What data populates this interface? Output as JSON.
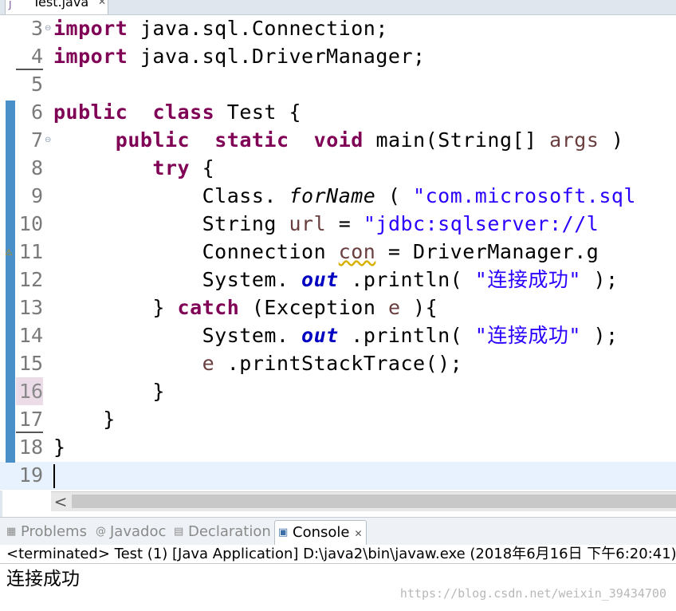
{
  "editor_tab": {
    "title": "Test.java",
    "close": "✕"
  },
  "icons": {
    "java_file": "java-file-icon",
    "fold": "fold-minus-icon",
    "warning": "warning-bulb-icon"
  },
  "code_lines": [
    {
      "num": "3",
      "tokens": [
        [
          "kw",
          "import"
        ],
        [
          "",
          "java.sql.Connection;"
        ]
      ]
    },
    {
      "num": "4",
      "tokens": [
        [
          "kw",
          "import"
        ],
        [
          "",
          "java.sql.DriverManager;"
        ]
      ]
    },
    {
      "num": "5",
      "tokens": []
    },
    {
      "num": "6",
      "tokens": [
        [
          "kw",
          "public"
        ],
        [
          "",
          ""
        ],
        [
          "kw",
          "class"
        ],
        [
          "",
          "Test {"
        ]
      ]
    },
    {
      "num": "7",
      "tokens": [
        [
          "",
          ""
        ],
        [
          "kw",
          "public"
        ],
        [
          "",
          ""
        ],
        [
          "kw",
          "static"
        ],
        [
          "",
          ""
        ],
        [
          "kw",
          "void"
        ],
        [
          "",
          "main(String[]"
        ],
        [
          "var",
          "args"
        ],
        [
          "",
          ")"
        ]
      ]
    },
    {
      "num": "8",
      "tokens": [
        [
          "kw",
          "try"
        ],
        [
          "",
          "{"
        ]
      ]
    },
    {
      "num": "9",
      "tokens": [
        [
          "",
          "Class."
        ],
        [
          "ital",
          "forName"
        ],
        [
          "",
          "("
        ],
        [
          "str",
          "\"com.microsoft.sql"
        ]
      ]
    },
    {
      "num": "10",
      "tokens": [
        [
          "",
          "String"
        ],
        [
          "var",
          "url"
        ],
        [
          "",
          "="
        ],
        [
          "str",
          "\"jdbc:sqlserver://l"
        ]
      ]
    },
    {
      "num": "11",
      "tokens": [
        [
          "",
          "Connection"
        ],
        [
          "var squig",
          "con"
        ],
        [
          "",
          "= DriverManager.g"
        ]
      ]
    },
    {
      "num": "12",
      "tokens": [
        [
          "",
          "System."
        ],
        [
          "fld",
          "out"
        ],
        [
          "",
          ".println("
        ],
        [
          "str",
          "\"连接成功\""
        ],
        [
          "",
          ");"
        ]
      ]
    },
    {
      "num": "13",
      "tokens": [
        [
          "",
          "}"
        ],
        [
          "kw",
          "catch"
        ],
        [
          "",
          "(Exception"
        ],
        [
          "var",
          "e"
        ],
        [
          "",
          "){"
        ]
      ]
    },
    {
      "num": "14",
      "tokens": [
        [
          "",
          "System."
        ],
        [
          "fld",
          "out"
        ],
        [
          "",
          ".println("
        ],
        [
          "str",
          "\"连接成功\""
        ],
        [
          "",
          ");"
        ]
      ]
    },
    {
      "num": "15",
      "tokens": [
        [
          "var",
          "e"
        ],
        [
          "",
          ".printStackTrace();"
        ]
      ]
    },
    {
      "num": "16",
      "tokens": [
        [
          "",
          "}"
        ]
      ]
    },
    {
      "num": "17",
      "tokens": [
        [
          "",
          "}"
        ]
      ]
    },
    {
      "num": "18",
      "tokens": [
        [
          "",
          "}"
        ]
      ]
    },
    {
      "num": "19",
      "tokens": []
    }
  ],
  "panel_tabs": [
    {
      "id": "problems",
      "label": "Problems",
      "icon": "problems-icon"
    },
    {
      "id": "javadoc",
      "label": "Javadoc",
      "icon": "javadoc-icon"
    },
    {
      "id": "declaration",
      "label": "Declaration",
      "icon": "declaration-icon"
    },
    {
      "id": "console",
      "label": "Console",
      "icon": "console-icon",
      "active": true
    }
  ],
  "console": {
    "header": "<terminated> Test (1) [Java Application] D:\\java2\\bin\\javaw.exe (2018年6月16日 下午6:20:41)",
    "output": "连接成功",
    "close": "✕"
  },
  "watermark": "https://blog.csdn.net/weixin_39434700",
  "scrollbar": {
    "left_arrow": "<"
  }
}
